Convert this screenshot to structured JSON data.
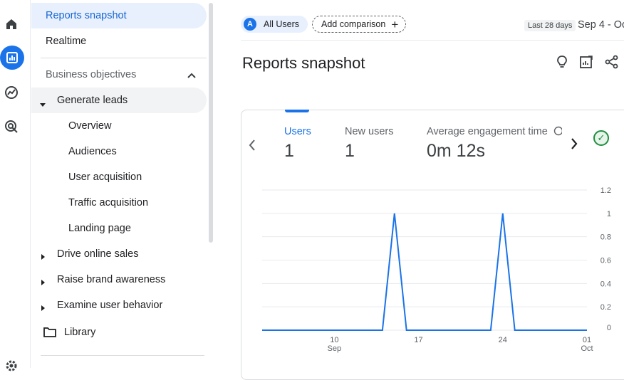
{
  "rail": {
    "icons": [
      "home-icon",
      "reports-icon",
      "explore-icon",
      "advertising-icon",
      "settings-icon"
    ]
  },
  "nav": {
    "reports_snapshot": "Reports snapshot",
    "realtime": "Realtime",
    "business_objectives": "Business objectives",
    "generate_leads": "Generate leads",
    "sub_items": [
      "Overview",
      "Audiences",
      "User acquisition",
      "Traffic acquisition",
      "Landing page"
    ],
    "drive_online_sales": "Drive online sales",
    "raise_brand_awareness": "Raise brand awareness",
    "examine_user_behavior": "Examine user behavior",
    "library": "Library"
  },
  "header": {
    "segment_badge": "A",
    "segment_label": "All Users",
    "add_comparison": "Add comparison",
    "date_label": "Last 28 days",
    "date_range": "Sep 4 - Oc"
  },
  "page": {
    "title": "Reports snapshot"
  },
  "metrics": [
    {
      "label": "Users",
      "value": "1"
    },
    {
      "label": "New users",
      "value": "1"
    },
    {
      "label": "Average engagement time",
      "value": "0m 12s"
    }
  ],
  "colors": {
    "accent": "#1a73e8",
    "success": "#1e8e3e"
  },
  "chart_data": {
    "type": "line",
    "series": [
      {
        "values": [
          0,
          0,
          0,
          0,
          0,
          0,
          0,
          0,
          0,
          0,
          0,
          1,
          0,
          0,
          0,
          0,
          0,
          0,
          0,
          0,
          1,
          0,
          0,
          0,
          0,
          0,
          0,
          0
        ]
      }
    ],
    "x": [
      "Sep 4",
      "Sep 5",
      "Sep 6",
      "Sep 7",
      "Sep 8",
      "Sep 9",
      "Sep 10",
      "Sep 11",
      "Sep 12",
      "Sep 13",
      "Sep 14",
      "Sep 15",
      "Sep 16",
      "Sep 17",
      "Sep 18",
      "Sep 19",
      "Sep 20",
      "Sep 21",
      "Sep 22",
      "Sep 23",
      "Sep 24",
      "Sep 25",
      "Sep 26",
      "Sep 27",
      "Sep 28",
      "Sep 29",
      "Sep 30",
      "Oct 1"
    ],
    "x_ticks": [
      {
        "day": "10",
        "month": "Sep"
      },
      {
        "day": "17",
        "month": ""
      },
      {
        "day": "24",
        "month": ""
      },
      {
        "day": "01",
        "month": "Oct"
      }
    ],
    "y_ticks": [
      "1.2",
      "1",
      "0.8",
      "0.6",
      "0.4",
      "0.2",
      "0"
    ],
    "ylim": [
      0,
      1.2
    ],
    "grid": true
  }
}
